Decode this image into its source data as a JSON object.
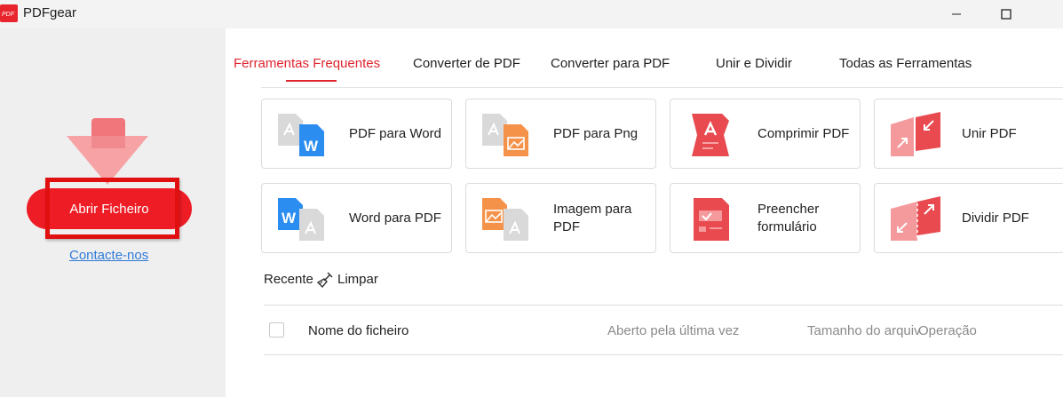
{
  "window": {
    "title": "PDFgear",
    "logo_text": "PDF"
  },
  "sidebar": {
    "open_button_label": "Abrir Ficheiro",
    "contact_link_label": "Contacte-nos"
  },
  "tabs": [
    {
      "label": "Ferramentas Frequentes",
      "active": true
    },
    {
      "label": "Converter de PDF",
      "active": false
    },
    {
      "label": "Converter para PDF",
      "active": false
    },
    {
      "label": "Unir e Dividir",
      "active": false
    },
    {
      "label": "Todas as Ferramentas",
      "active": false
    }
  ],
  "tools": [
    {
      "label": "PDF para Word",
      "icon": "pdf-to-word-icon"
    },
    {
      "label": "PDF para Png",
      "icon": "pdf-to-png-icon"
    },
    {
      "label": "Comprimir PDF",
      "icon": "compress-pdf-icon"
    },
    {
      "label": "Unir PDF",
      "icon": "merge-pdf-icon"
    },
    {
      "label": "Word para PDF",
      "icon": "word-to-pdf-icon"
    },
    {
      "label": "Imagem para PDF",
      "icon": "image-to-pdf-icon"
    },
    {
      "label": "Preencher formulário",
      "icon": "fill-form-icon"
    },
    {
      "label": "Dividir PDF",
      "icon": "split-pdf-icon"
    }
  ],
  "recent": {
    "title": "Recente",
    "clear_label": "Limpar",
    "columns": {
      "name": "Nome do ficheiro",
      "opened": "Aberto pela última vez",
      "size": "Tamanho do arquiv",
      "operation": "Operação"
    }
  },
  "colors": {
    "accent": "#ee1c25",
    "tab_active": "#e0242e",
    "link": "#2f7bd8",
    "highlight_box": "#e11010"
  }
}
